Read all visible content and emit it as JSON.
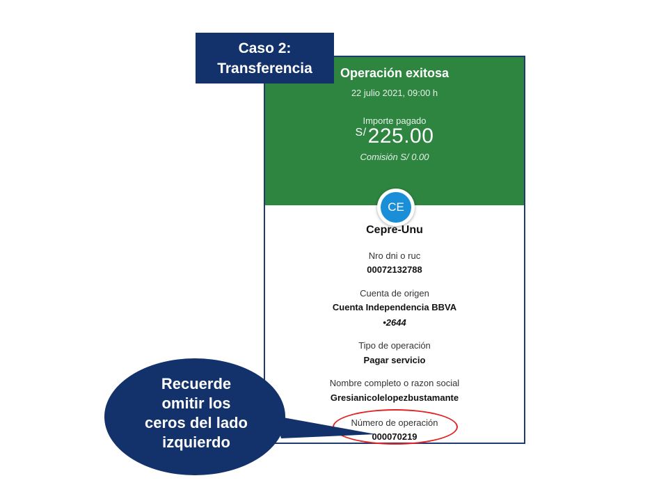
{
  "case_label": {
    "line1": "Caso 2:",
    "line2": "Transferencia"
  },
  "receipt": {
    "title": "Operación exitosa",
    "date": "22 julio 2021, 09:00 h",
    "amount_label": "Importe pagado",
    "currency": "S/",
    "amount": "225.00",
    "commission": "Comisión  S/ 0.00",
    "avatar_initials": "CE",
    "beneficiary": "Cepre-Unu",
    "fields": [
      {
        "label": "Nro dni o ruc",
        "value": "00072132788"
      },
      {
        "label": "Cuenta de origen",
        "value": "Cuenta Independencia BBVA",
        "value2": "•2644"
      },
      {
        "label": "Tipo de operación",
        "value": "Pagar servicio"
      },
      {
        "label": "Nombre completo o razon social",
        "value": "Gresianicolelopezbustamante"
      },
      {
        "label": "Número de operación",
        "value": "000070219"
      }
    ]
  },
  "callout": {
    "line1": "Recuerde",
    "line2": "omitir los",
    "line3": "ceros del lado",
    "line4": "izquierdo"
  },
  "colors": {
    "header_green": "#2e8540",
    "navy": "#13326b",
    "highlight_red": "#e32222",
    "avatar_blue": "#1a8fd8"
  }
}
